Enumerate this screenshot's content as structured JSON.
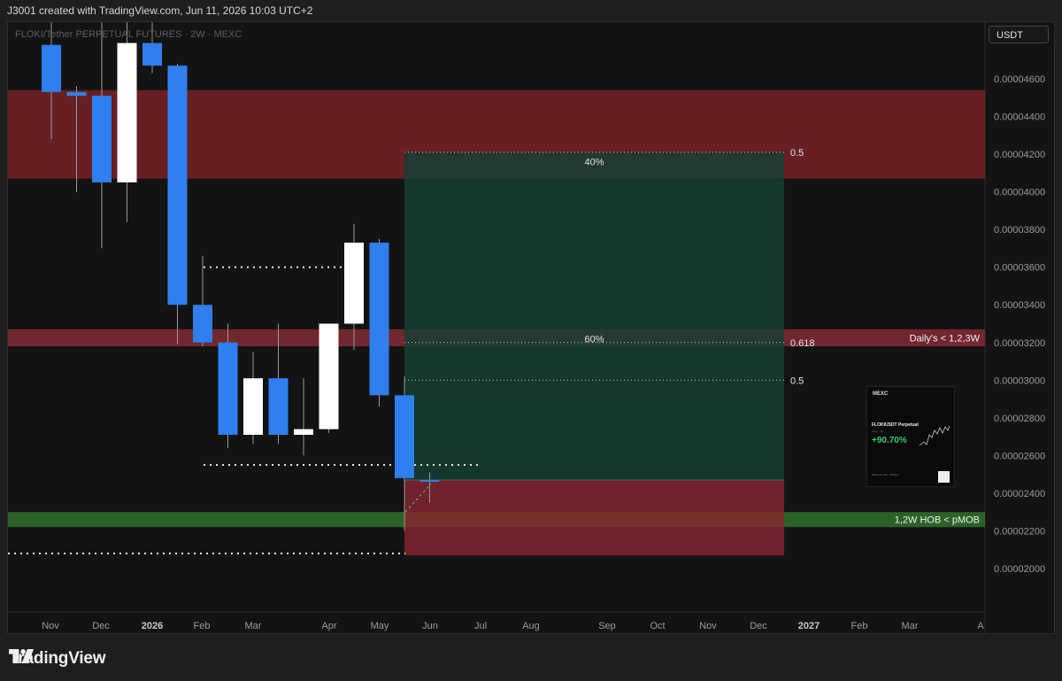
{
  "header": {
    "attribution": "J3001 created with TradingView.com, Jun 11, 2026 10:03 UTC+2"
  },
  "symbol": {
    "title": "FLOKI/Tether PERPETUAL FUTURES · 2W · MEXC"
  },
  "currency": "USDT",
  "footer": {
    "brand": "TradingView"
  },
  "promo": {
    "brand": "MEXC",
    "pair": "FLOKIUSDT Perpetual",
    "mode": "Long · 1X",
    "pnl": "+90.70%",
    "referral": "Referral code: 12CPp3"
  },
  "colors": {
    "up_body": "#ffffff",
    "down_body": "#2f7ff0",
    "supply_zone": "#7a2228",
    "target_zone": "#173e34",
    "stop_zone": "#8a2530",
    "demand_zone": "#2f6b2a",
    "background": "#131313"
  },
  "chart_data": {
    "type": "candlestick",
    "title": "FLOKI/Tether PERPETUAL FUTURES · 2W · MEXC",
    "timeframe": "2W",
    "ylim": [
      1.9e-05,
      4.88e-05
    ],
    "y_ticks": [
      "0.00002000",
      "0.00002200",
      "0.00002400",
      "0.00002600",
      "0.00002800",
      "0.00003000",
      "0.00003200",
      "0.00003400",
      "0.00003600",
      "0.00003800",
      "0.00004000",
      "0.00004200",
      "0.00004400",
      "0.00004600"
    ],
    "x_ticks": [
      "Nov",
      "Dec",
      "2026",
      "Feb",
      "Mar",
      "Apr",
      "May",
      "Jun",
      "Jul",
      "Aug",
      "Sep",
      "Oct",
      "Nov",
      "Dec",
      "2027",
      "Feb",
      "Mar",
      "A"
    ],
    "x_ticks_bold": [
      "2026",
      "2027"
    ],
    "candles": [
      {
        "o": 4.78e-05,
        "h": 4.9e-05,
        "l": 4.28e-05,
        "c": 4.53e-05,
        "dir": "down"
      },
      {
        "o": 4.53e-05,
        "h": 4.56e-05,
        "l": 4e-05,
        "c": 4.51e-05,
        "dir": "down"
      },
      {
        "o": 4.51e-05,
        "h": 4.9e-05,
        "l": 3.7e-05,
        "c": 4.05e-05,
        "dir": "down"
      },
      {
        "o": 4.05e-05,
        "h": 4.9e-05,
        "l": 3.84e-05,
        "c": 4.79e-05,
        "dir": "up"
      },
      {
        "o": 4.79e-05,
        "h": 4.9e-05,
        "l": 4.63e-05,
        "c": 4.67e-05,
        "dir": "down"
      },
      {
        "o": 4.67e-05,
        "h": 4.68e-05,
        "l": 3.19e-05,
        "c": 3.4e-05,
        "dir": "down"
      },
      {
        "o": 3.4e-05,
        "h": 3.66e-05,
        "l": 3.18e-05,
        "c": 3.2e-05,
        "dir": "down"
      },
      {
        "o": 3.2e-05,
        "h": 3.3e-05,
        "l": 2.64e-05,
        "c": 2.71e-05,
        "dir": "down"
      },
      {
        "o": 2.71e-05,
        "h": 3.15e-05,
        "l": 2.66e-05,
        "c": 3.01e-05,
        "dir": "up"
      },
      {
        "o": 3.01e-05,
        "h": 3.3e-05,
        "l": 2.66e-05,
        "c": 2.71e-05,
        "dir": "down"
      },
      {
        "o": 2.71e-05,
        "h": 3.01e-05,
        "l": 2.6e-05,
        "c": 2.74e-05,
        "dir": "up"
      },
      {
        "o": 2.74e-05,
        "h": 3.3e-05,
        "l": 2.72e-05,
        "c": 3.3e-05,
        "dir": "up"
      },
      {
        "o": 3.3e-05,
        "h": 3.83e-05,
        "l": 3.16e-05,
        "c": 3.73e-05,
        "dir": "up"
      },
      {
        "o": 3.73e-05,
        "h": 3.75e-05,
        "l": 2.86e-05,
        "c": 2.92e-05,
        "dir": "down"
      },
      {
        "o": 2.92e-05,
        "h": 3.02e-05,
        "l": 2.2e-05,
        "c": 2.48e-05,
        "dir": "down"
      },
      {
        "o": 2.47e-05,
        "h": 2.51e-05,
        "l": 2.35e-05,
        "c": 2.47e-05,
        "dir": "down"
      }
    ],
    "zones": [
      {
        "name": "supply",
        "from": 4.07e-05,
        "to": 4.54e-05
      },
      {
        "name": "Daily's < 1,2,3W",
        "label": "Daily's < 1,2,3W",
        "from": 3.18e-05,
        "to": 3.27e-05
      },
      {
        "name": "1,2W HOB < pMOB",
        "label": "1,2W HOB < pMOB",
        "from": 2.22e-05,
        "to": 2.3e-05
      }
    ],
    "position": {
      "type": "long",
      "entry": 2.47e-05,
      "target": 4.21e-05,
      "stop": 2.07e-05,
      "labels": [
        {
          "text": "40%",
          "price": 4.16e-05
        },
        {
          "text": "60%",
          "price": 3.22e-05
        }
      ]
    },
    "fib_levels": [
      {
        "label": "0.5",
        "price": 4.21e-05
      },
      {
        "label": "0.618",
        "price": 3.2e-05
      },
      {
        "label": "0.5",
        "price": 3e-05
      }
    ],
    "dotted_levels": [
      3.6e-05,
      2.55e-05,
      2.08e-05
    ]
  }
}
